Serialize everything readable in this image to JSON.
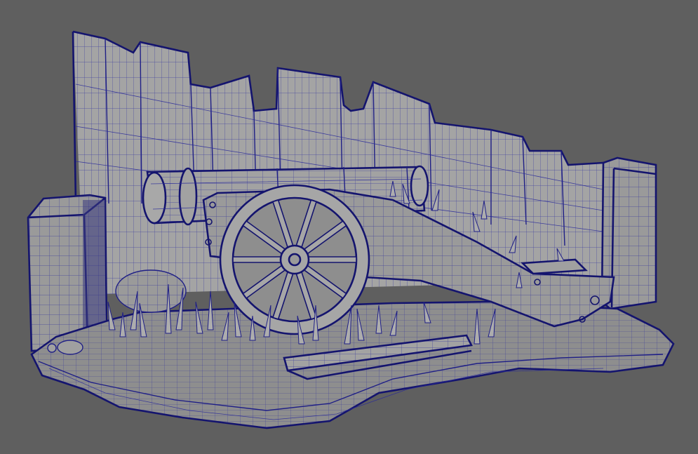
{
  "viewport": {
    "background_color": "#5f5f5f",
    "surface_color": "#9a9a9a",
    "wireframe_color": "#1f1f86",
    "display_mode": "wireframe-on-shaded"
  },
  "scene": {
    "objects": [
      "broken-stone-wall",
      "left-stone-pillar",
      "right-stone-pillar",
      "cannon-barrel",
      "cannon-carriage",
      "spoked-wheel",
      "grass-blades",
      "wooden-plank",
      "rocks",
      "terrain-base"
    ],
    "wheel_spokes": 10
  }
}
